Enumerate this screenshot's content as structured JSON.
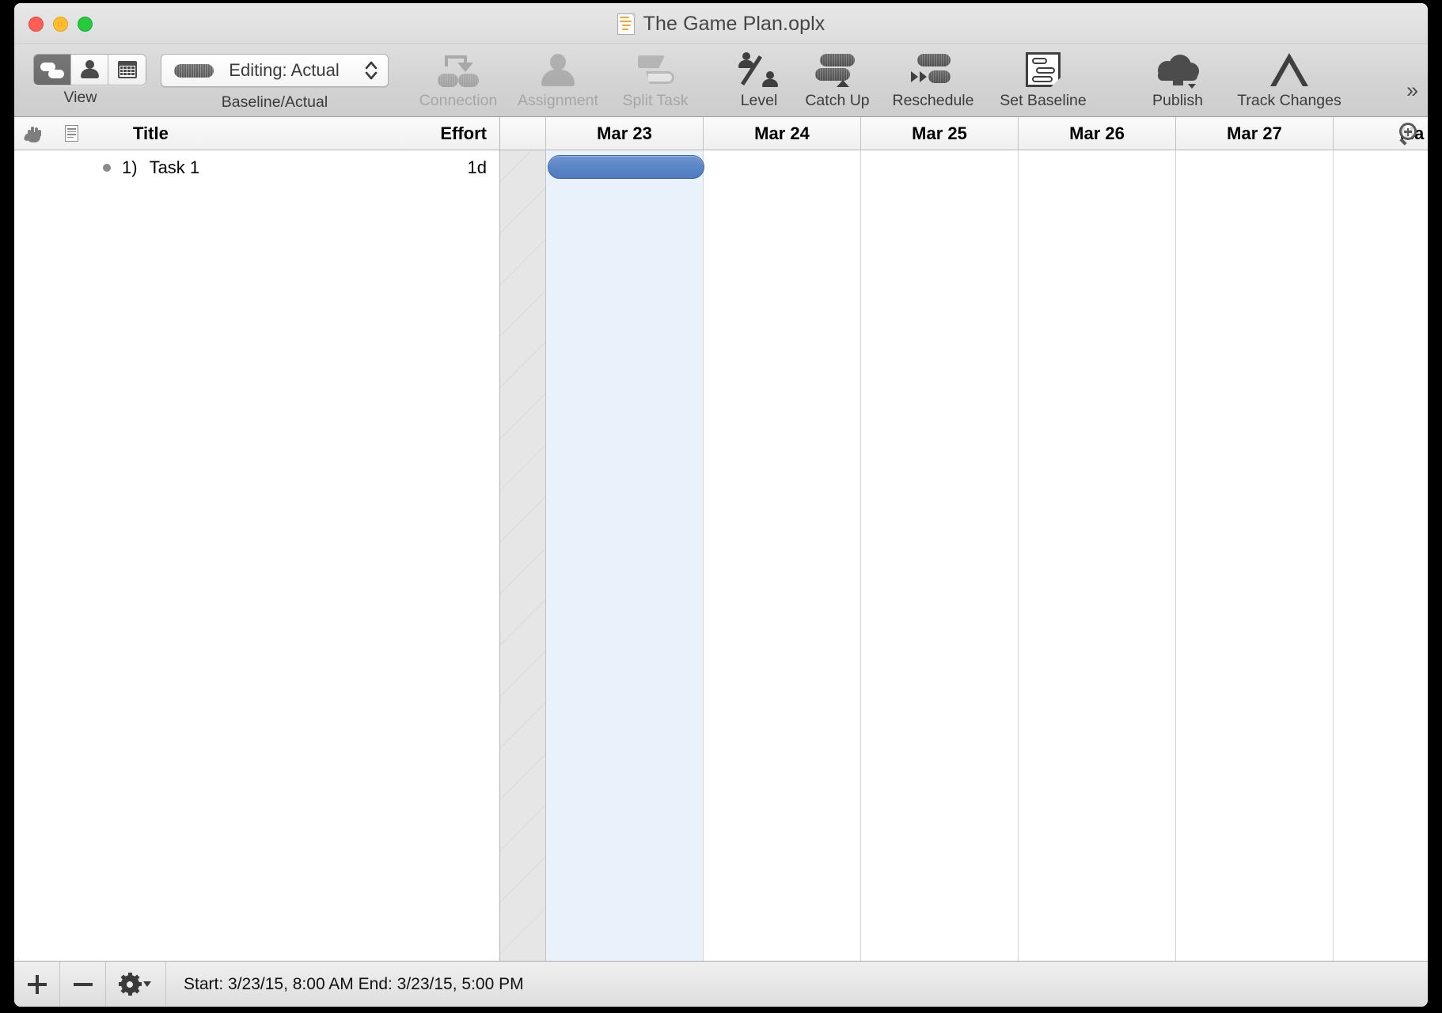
{
  "window": {
    "title": "The Game Plan.oplx",
    "doc_icon": "document-icon",
    "traffic_lights": [
      "close",
      "minimize",
      "zoom"
    ]
  },
  "toolbar": {
    "view_group": {
      "label": "View",
      "segments": [
        {
          "name": "gantt-view",
          "icon": "gantt-icon",
          "selected": true
        },
        {
          "name": "resource-view",
          "icon": "person-icon",
          "selected": false
        },
        {
          "name": "calendar-view",
          "icon": "calendar-icon",
          "selected": false
        }
      ]
    },
    "baseline_group": {
      "label": "Baseline/Actual",
      "value": "Editing: Actual",
      "swatch_icon": "bar-swatch-icon",
      "stepper_icon": "stepper-icon"
    },
    "items": [
      {
        "label": "Connection",
        "icon": "connection-icon",
        "enabled": false
      },
      {
        "label": "Assignment",
        "icon": "assignment-icon",
        "enabled": false
      },
      {
        "label": "Split Task",
        "icon": "split-task-icon",
        "enabled": false
      },
      {
        "label": "Level",
        "icon": "level-icon",
        "enabled": true
      },
      {
        "label": "Catch Up",
        "icon": "catch-up-icon",
        "enabled": true
      },
      {
        "label": "Reschedule",
        "icon": "reschedule-icon",
        "enabled": true
      },
      {
        "label": "Set Baseline",
        "icon": "set-baseline-icon",
        "enabled": true
      },
      {
        "label": "Publish",
        "icon": "publish-cloud-icon",
        "enabled": true
      },
      {
        "label": "Track Changes",
        "icon": "track-changes-icon",
        "enabled": true
      }
    ],
    "overflow_label": "»"
  },
  "outline": {
    "columns": {
      "lock_icon": "hand-icon",
      "note_icon": "note-icon",
      "title": "Title",
      "effort": "Effort"
    },
    "rows": [
      {
        "bullet": "•",
        "number": "1)",
        "title": "Task 1",
        "effort": "1d"
      }
    ]
  },
  "gantt": {
    "gutter_label": "",
    "columns": [
      {
        "label": "Mar 23",
        "today": true
      },
      {
        "label": "Mar 24",
        "today": false
      },
      {
        "label": "Mar 25",
        "today": false
      },
      {
        "label": "Mar 26",
        "today": false
      },
      {
        "label": "Mar 27",
        "today": false
      },
      {
        "label": "Ma",
        "today": false
      }
    ],
    "zoom_icon": "zoom-in-icon",
    "bar": {
      "name": "task-1-bar",
      "color": "#5b86c6",
      "border_color": "#3e63a0"
    }
  },
  "statusbar": {
    "add_label": "+",
    "remove_label": "−",
    "gear_icon": "gear-icon",
    "status_text": "Start: 3/23/15, 8:00 AM End: 3/23/15, 5:00 PM"
  }
}
